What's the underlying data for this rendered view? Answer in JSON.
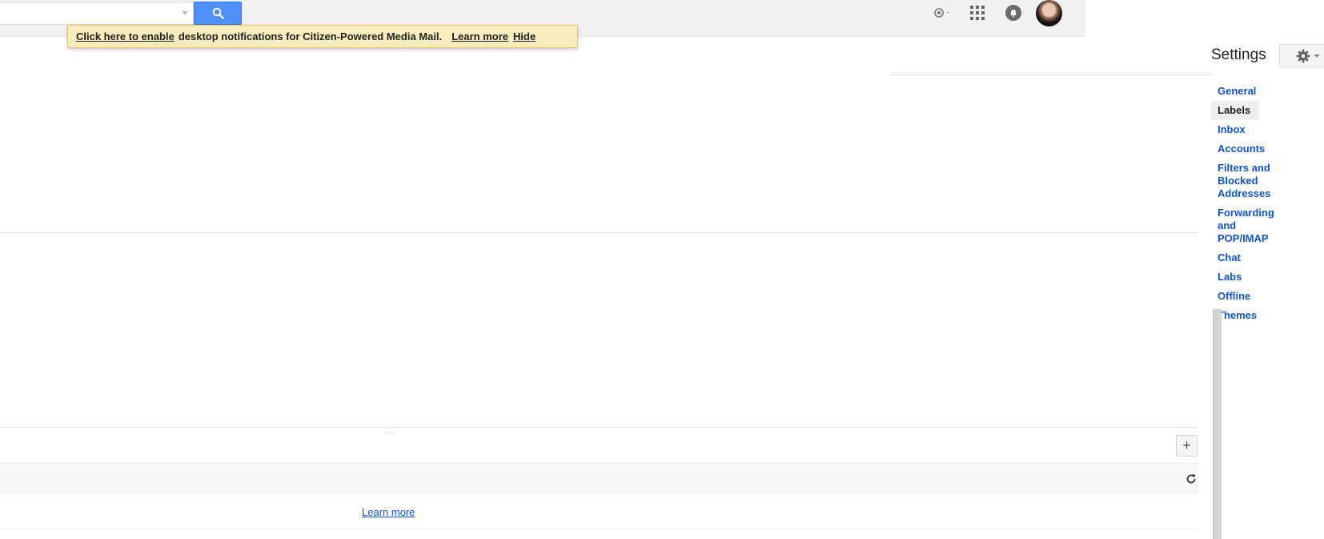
{
  "notification": {
    "enable_link": "Click here to enable",
    "message": "desktop notifications for Citizen-Powered Media Mail.",
    "learn_more": "Learn more",
    "hide": "Hide"
  },
  "settings": {
    "title": "Settings",
    "nav": [
      {
        "label": "General",
        "active": false
      },
      {
        "label": "Labels",
        "active": true
      },
      {
        "label": "Inbox",
        "active": false
      },
      {
        "label": "Accounts",
        "active": false
      },
      {
        "label": "Filters and Blocked Addresses",
        "active": false
      },
      {
        "label": "Forwarding and POP/IMAP",
        "active": false
      },
      {
        "label": "Chat",
        "active": false
      },
      {
        "label": "Labs",
        "active": false
      },
      {
        "label": "Offline",
        "active": false
      },
      {
        "label": "Themes",
        "active": false
      }
    ]
  },
  "content": {
    "plus_label": "+",
    "learn_more": "Learn more"
  },
  "icons": {
    "search": "search-icon",
    "apps": "apps-grid-icon",
    "notifications": "bell-icon",
    "hangouts": "hangouts-status-icon",
    "settings": "gear-icon",
    "refresh": "refresh-icon"
  },
  "colors": {
    "accent_blue": "#4d90fe",
    "link_blue": "#1155cc",
    "notify_bg": "#f9edbe",
    "notify_border": "#f0c36d"
  }
}
